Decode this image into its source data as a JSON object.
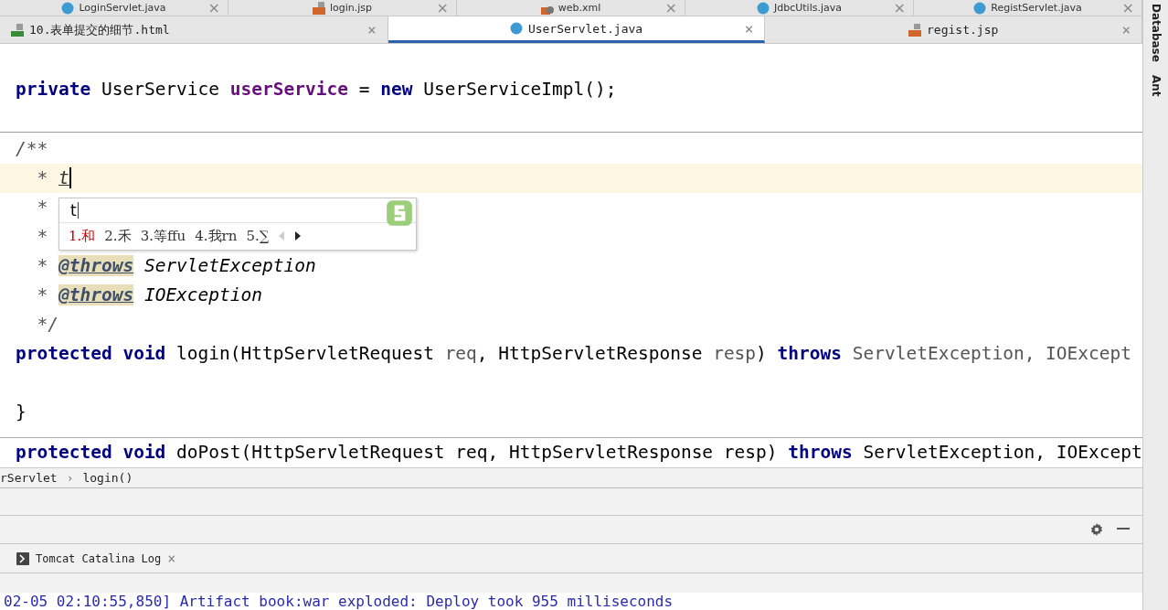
{
  "top_tabs": [
    {
      "label": "LoginServlet.java",
      "kind": "class",
      "close": "×"
    },
    {
      "label": "login.jsp",
      "kind": "jsp",
      "close": "×"
    },
    {
      "label": "web.xml",
      "kind": "xml",
      "close": "×"
    },
    {
      "label": "JdbcUtils.java",
      "kind": "class",
      "close": "×"
    },
    {
      "label": "RegistServlet.java",
      "kind": "class",
      "close": "×"
    }
  ],
  "tabs": [
    {
      "label": "10.表单提交的细节.html",
      "kind": "html",
      "selected": false,
      "close": "×"
    },
    {
      "label": "UserServlet.java",
      "kind": "class",
      "selected": true,
      "close": "×"
    },
    {
      "label": "regist.jsp",
      "kind": "jsp",
      "selected": false,
      "close": "×"
    }
  ],
  "code_lines": [
    {
      "highlighted": false
    },
    {
      "highlighted": false,
      "segments": [
        {
          "text": "private",
          "kind": "keyword"
        },
        {
          "text": " UserService ",
          "kind": "plain"
        },
        {
          "text": "userService",
          "kind": "field"
        },
        {
          "text": " = ",
          "kind": "plain"
        },
        {
          "text": "new",
          "kind": "keyword"
        },
        {
          "text": " UserServiceImpl();",
          "kind": "plain"
        }
      ]
    },
    {
      "highlighted": false
    },
    {
      "highlighted": false,
      "segments": [
        {
          "text": "/**",
          "kind": "comment"
        }
      ]
    },
    {
      "highlighted": true,
      "segments": [
        {
          "text": "  * ",
          "kind": "comment"
        },
        {
          "text": "t",
          "kind": "typed"
        }
      ]
    },
    {
      "highlighted": false,
      "segments": [
        {
          "text": "  *",
          "kind": "comment"
        }
      ]
    },
    {
      "highlighted": false,
      "segments": [
        {
          "text": "  *",
          "kind": "comment"
        }
      ]
    },
    {
      "highlighted": false,
      "segments": [
        {
          "text": "  * ",
          "kind": "comment"
        },
        {
          "text": "@throws",
          "kind": "tag"
        },
        {
          "text": " ServletException",
          "kind": "param"
        }
      ]
    },
    {
      "highlighted": false,
      "segments": [
        {
          "text": "  * ",
          "kind": "comment"
        },
        {
          "text": "@throws",
          "kind": "tag"
        },
        {
          "text": " IOException",
          "kind": "param"
        }
      ]
    },
    {
      "highlighted": false,
      "segments": [
        {
          "text": "  */",
          "kind": "comment"
        }
      ]
    },
    {
      "highlighted": false,
      "segments": [
        {
          "text": "protected void",
          "kind": "keyword"
        },
        {
          "text": " login(HttpServletRequest ",
          "kind": "plain"
        },
        {
          "text": "req",
          "kind": "gray"
        },
        {
          "text": ", HttpServletResponse ",
          "kind": "plain"
        },
        {
          "text": "resp",
          "kind": "gray"
        },
        {
          "text": ") ",
          "kind": "plain"
        },
        {
          "text": "throws",
          "kind": "keyword"
        },
        {
          "text": " ServletException, IOExcept",
          "kind": "gray"
        }
      ]
    },
    {
      "highlighted": false
    },
    {
      "highlighted": false,
      "segments": [
        {
          "text": "}",
          "kind": "plain"
        }
      ]
    }
  ],
  "sticky_line": [
    {
      "text": "protected void",
      "kind": "keyword"
    },
    {
      "text": " doPost(HttpServletRequest req, HttpServletResponse resp) ",
      "kind": "plain"
    },
    {
      "text": "throws",
      "kind": "keyword"
    },
    {
      "text": " ServletException, IOExcept",
      "kind": "plain"
    }
  ],
  "ime_popup": {
    "input": "t",
    "candidates": [
      {
        "label": "1.和",
        "selected": true
      },
      {
        "label": "2.禾",
        "selected": false
      },
      {
        "label": "3.等ffu",
        "selected": false
      },
      {
        "label": "4.我rn",
        "selected": false
      },
      {
        "label": "5.∑",
        "selected": false
      }
    ]
  },
  "breadcrumb": {
    "items": [
      "rServlet",
      "login()"
    ],
    "separator": "›"
  },
  "side_tools": [
    "Database",
    "Ant"
  ],
  "bottom_tabs": [
    {
      "label": "Tomcat Catalina Log",
      "close": "×"
    }
  ],
  "log_line": "02-05 02:10:55,850] Artifact book:war exploded: Deploy took 955 milliseconds"
}
